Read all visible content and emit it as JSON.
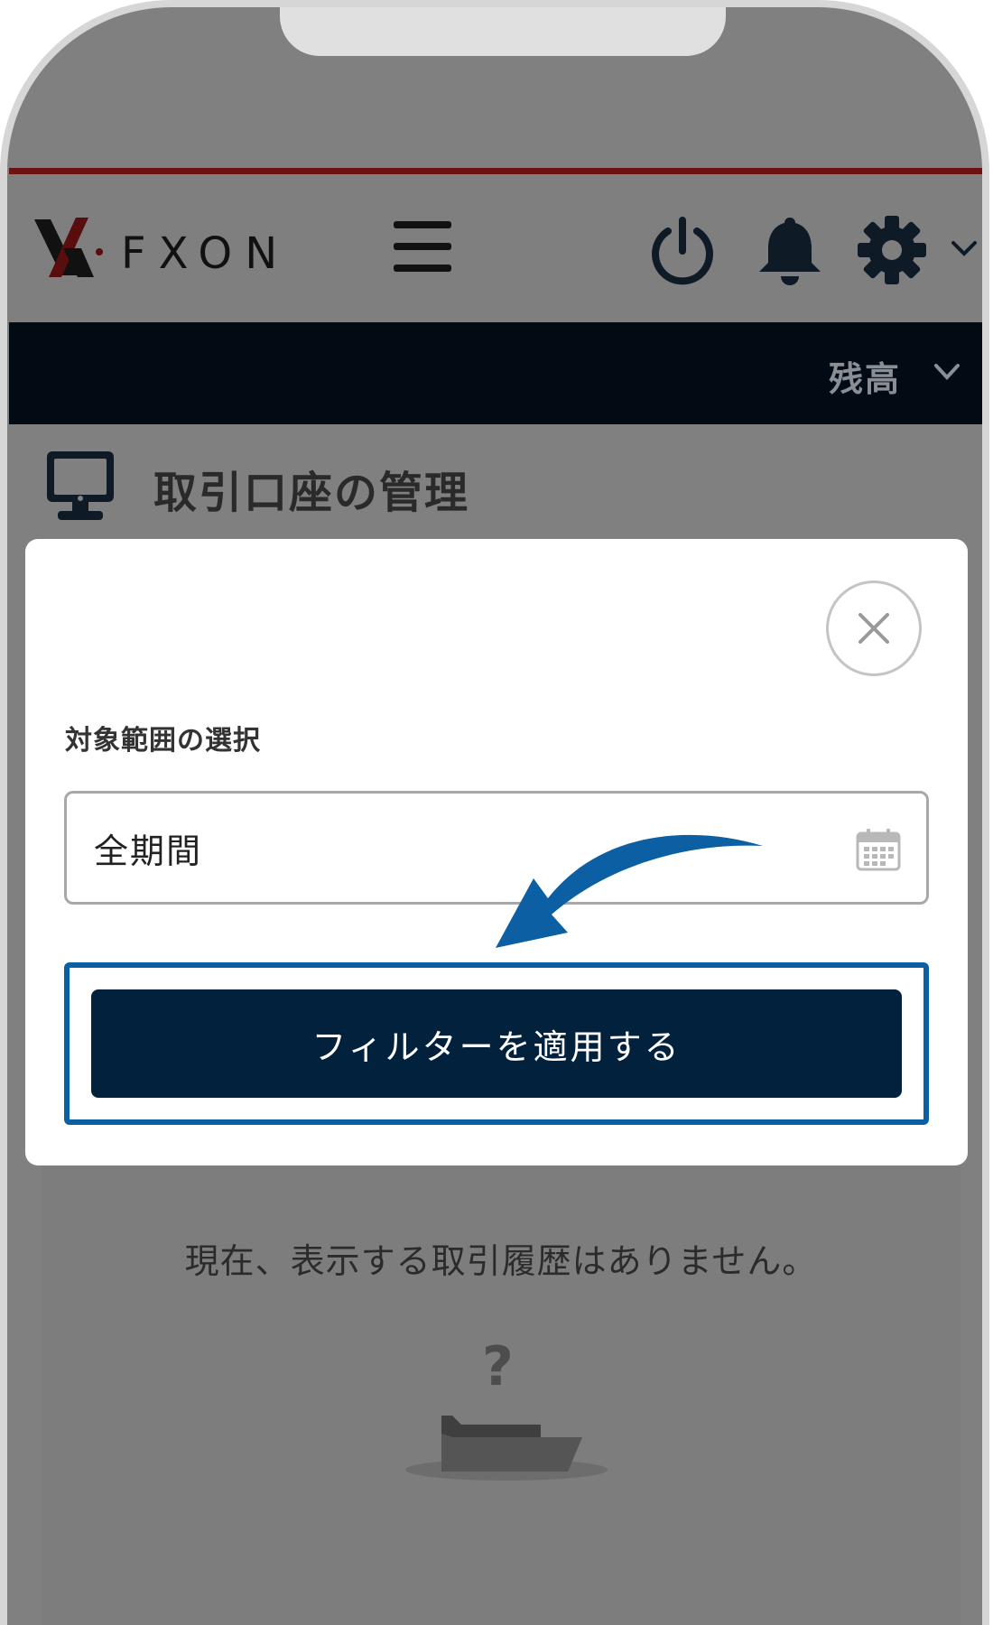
{
  "header": {
    "logo_text": "FXON"
  },
  "balance_bar": {
    "label": "残高"
  },
  "page": {
    "title": "取引口座の管理",
    "empty_message": "現在、表示する取引履歴はありません。"
  },
  "modal": {
    "field_label": "対象範囲の選択",
    "date_range_value": "全期間",
    "apply_button_label": "フィルターを適用する"
  },
  "icons": {
    "logo": "fxon-logo",
    "menu": "hamburger-menu-icon",
    "power": "power-icon",
    "notifications": "bell-icon",
    "settings": "gear-icon",
    "account": "monitor-icon",
    "close": "close-icon",
    "calendar": "calendar-icon",
    "empty": "folder-question-icon",
    "pointer": "curved-arrow-icon"
  },
  "colors": {
    "overlay_gray": "#808080",
    "navy": "#02213d",
    "balance_bar": "#020a13",
    "accent_red": "#6e1111",
    "highlight_blue": "#0d5fa3"
  }
}
